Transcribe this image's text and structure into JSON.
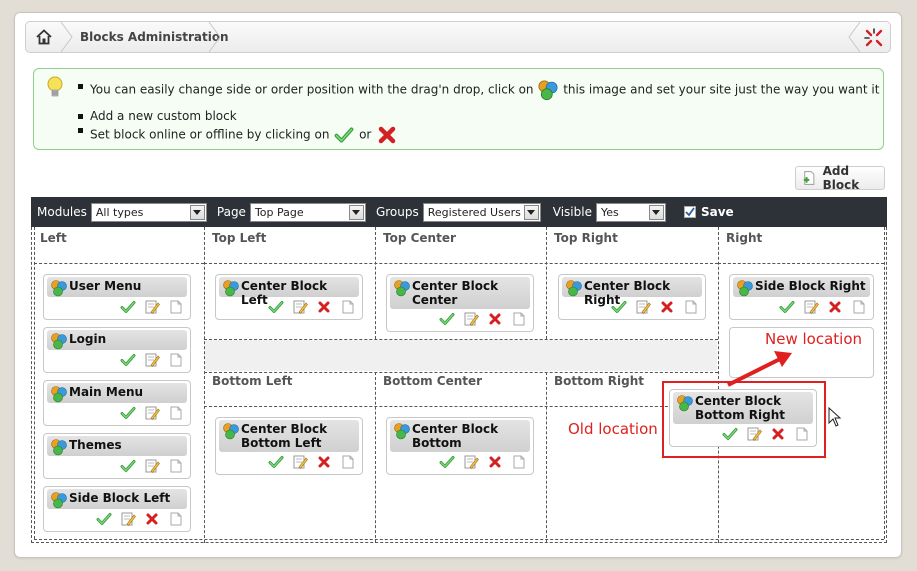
{
  "header": {
    "title": "Blocks Administration"
  },
  "info": {
    "line1_a": "You can easily change side or order position with the drag'n drop, click on",
    "line1_b": "this image and set your site just the way you want it",
    "line2": "Add a new custom block",
    "line3_a": "Set block online or offline by clicking on",
    "line3_or": "or"
  },
  "add_block_label": "Add Block",
  "toolbar": {
    "modules_label": "Modules",
    "modules_value": "All types",
    "page_label": "Page",
    "page_value": "Top Page",
    "groups_label": "Groups",
    "groups_value": "Registered Users",
    "visible_label": "Visible",
    "visible_value": "Yes",
    "save_label": "Save"
  },
  "zones": {
    "left": "Left",
    "top_left": "Top Left",
    "top_center": "Top Center",
    "top_right": "Top Right",
    "right": "Right",
    "bottom_left": "Bottom Left",
    "bottom_center": "Bottom Center",
    "bottom_right": "Bottom Right"
  },
  "blocks": {
    "user_menu": "User Menu",
    "login": "Login",
    "main_menu": "Main Menu",
    "themes": "Themes",
    "side_block_left": "Side Block Left",
    "center_block_left": "Center Block Left",
    "center_block_center": "Center Block Center",
    "center_block_right": "Center Block Right",
    "side_block_right": "Side Block Right",
    "center_block_bottom_left": "Center Block Bottom Left",
    "center_block_bottom": "Center Block Bottom",
    "center_block_bottom_right": "Center Block Bottom Right"
  },
  "annotations": {
    "new_location": "New location",
    "old_location": "Old location"
  },
  "colors": {
    "toolbar_bg": "#2d3239",
    "accent_red": "#e02020",
    "info_border": "#8fd08f"
  }
}
